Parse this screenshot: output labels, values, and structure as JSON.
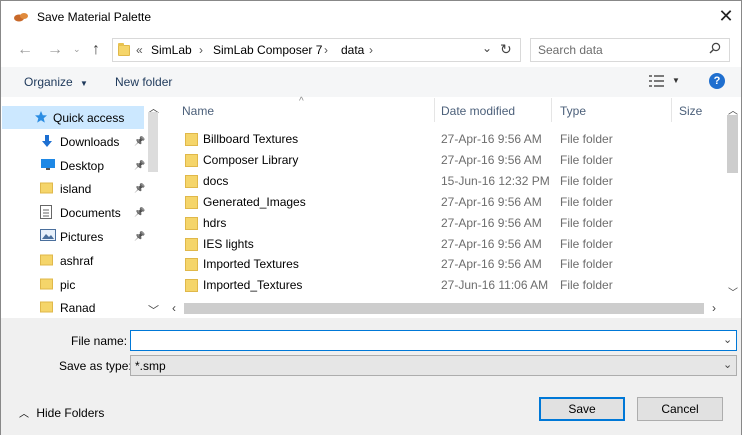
{
  "window": {
    "title": "Save Material Palette"
  },
  "address": {
    "chevron": "«",
    "segments": [
      "SimLab",
      "SimLab Composer 7",
      "data"
    ]
  },
  "search": {
    "placeholder": "Search data"
  },
  "toolbar": {
    "organize": "Organize",
    "new_folder": "New folder"
  },
  "nav": {
    "items": [
      {
        "label": "Quick access",
        "icon": "star-icon",
        "pinned": false,
        "selected": true
      },
      {
        "label": "Downloads",
        "icon": "download-icon",
        "pinned": true
      },
      {
        "label": "Desktop",
        "icon": "desktop-icon",
        "pinned": true
      },
      {
        "label": "island",
        "icon": "folder-icon",
        "pinned": true
      },
      {
        "label": "Documents",
        "icon": "documents-icon",
        "pinned": true
      },
      {
        "label": "Pictures",
        "icon": "pictures-icon",
        "pinned": true
      },
      {
        "label": "ashraf",
        "icon": "folder-icon",
        "pinned": false
      },
      {
        "label": "pic",
        "icon": "folder-icon",
        "pinned": false
      },
      {
        "label": "Ranad",
        "icon": "folder-icon",
        "pinned": false
      }
    ]
  },
  "columns": {
    "name": "Name",
    "date": "Date modified",
    "type": "Type",
    "size": "Size"
  },
  "files": [
    {
      "name": "Billboard Textures",
      "date": "27-Apr-16 9:56 AM",
      "type": "File folder"
    },
    {
      "name": "Composer Library",
      "date": "27-Apr-16 9:56 AM",
      "type": "File folder"
    },
    {
      "name": "docs",
      "date": "15-Jun-16 12:32 PM",
      "type": "File folder"
    },
    {
      "name": "Generated_Images",
      "date": "27-Apr-16 9:56 AM",
      "type": "File folder"
    },
    {
      "name": "hdrs",
      "date": "27-Apr-16 9:56 AM",
      "type": "File folder"
    },
    {
      "name": "IES lights",
      "date": "27-Apr-16 9:56 AM",
      "type": "File folder"
    },
    {
      "name": "Imported Textures",
      "date": "27-Apr-16 9:56 AM",
      "type": "File folder"
    },
    {
      "name": "Imported_Textures",
      "date": "27-Jun-16 11:06 AM",
      "type": "File folder"
    }
  ],
  "form": {
    "file_name_label": "File name:",
    "file_name_value": "",
    "save_type_label": "Save as type:",
    "save_type_value": "*.smp"
  },
  "footer": {
    "hide_folders": "Hide Folders",
    "save": "Save",
    "cancel": "Cancel"
  },
  "colors": {
    "accent": "#0078d7",
    "selected_nav": "#cce8ff",
    "folder": "#f5d56a",
    "help": "#1f6fcf"
  }
}
